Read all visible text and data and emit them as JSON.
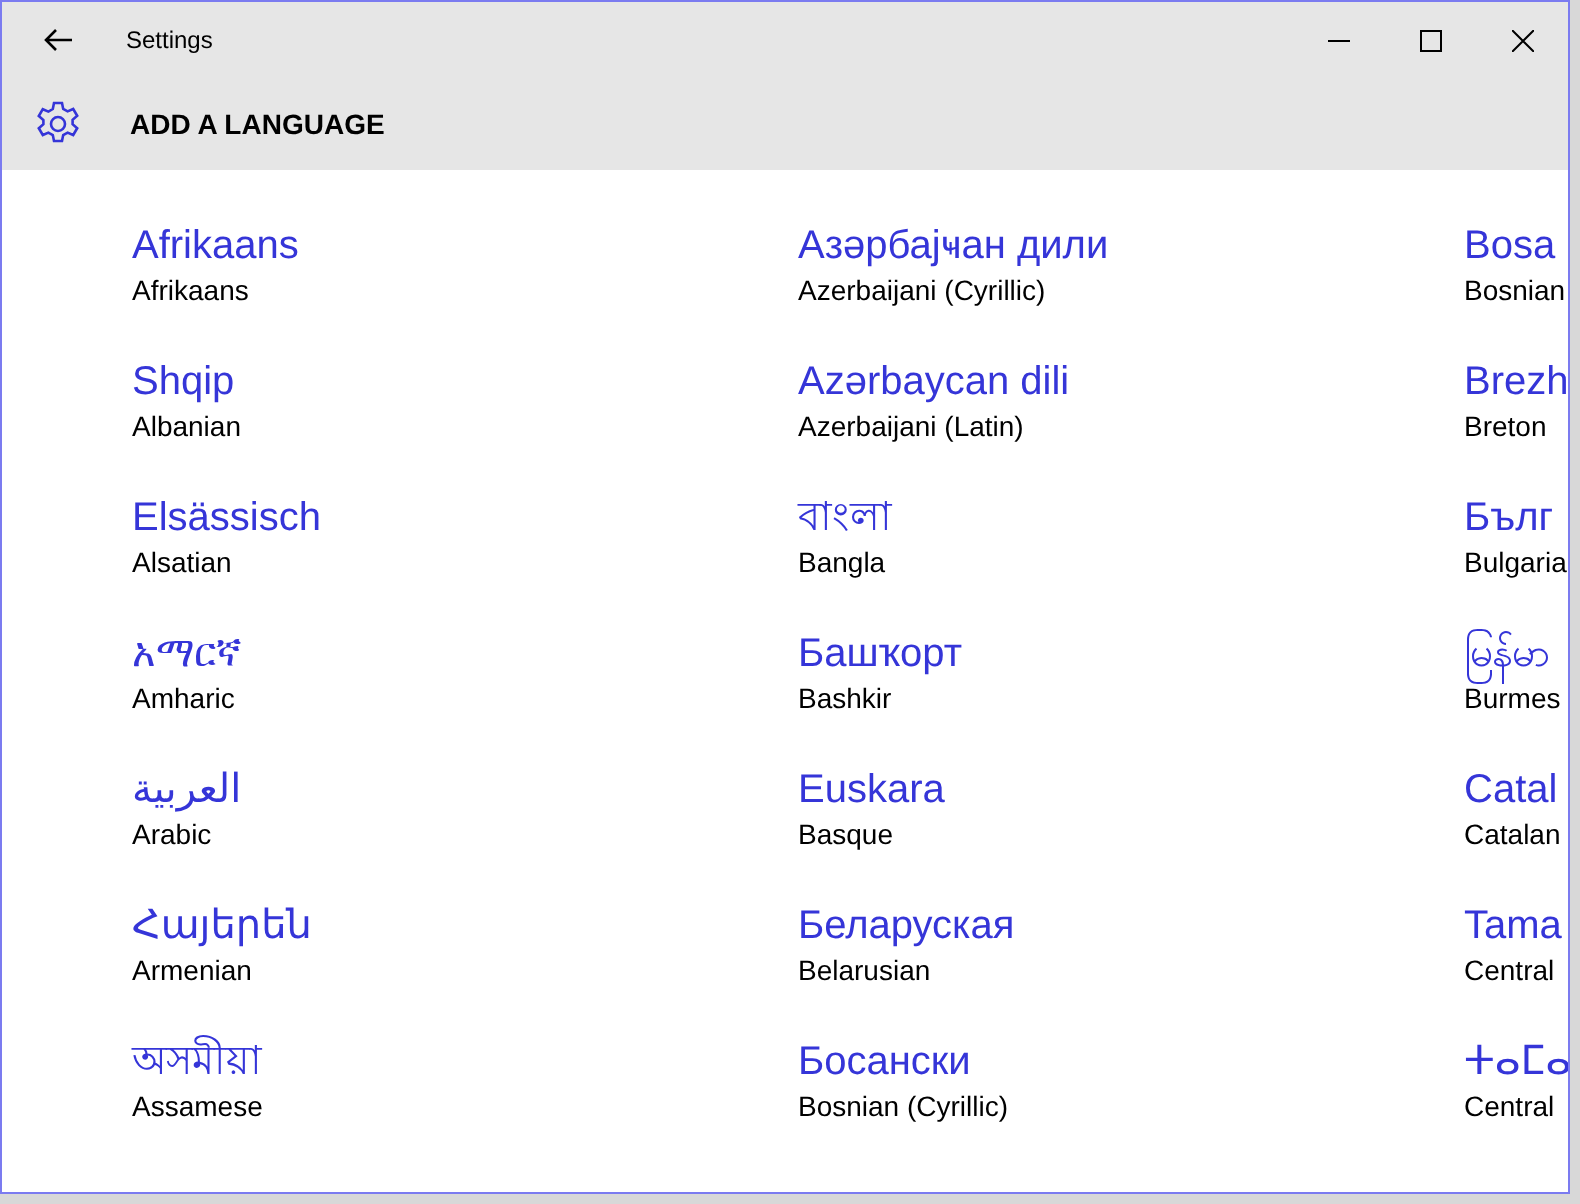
{
  "window": {
    "title": "Settings"
  },
  "header": {
    "title": "ADD A LANGUAGE"
  },
  "languages": [
    {
      "native": "Afrikaans",
      "english": "Afrikaans"
    },
    {
      "native": "Азәрбајҹан дили",
      "english": "Azerbaijani (Cyrillic)"
    },
    {
      "native": "Bosa",
      "english": "Bosnian"
    },
    {
      "native": "Shqip",
      "english": "Albanian"
    },
    {
      "native": "Azərbaycan dili",
      "english": "Azerbaijani (Latin)"
    },
    {
      "native": "Brezh",
      "english": "Breton"
    },
    {
      "native": "Elsässisch",
      "english": "Alsatian"
    },
    {
      "native": "বাংলা",
      "english": "Bangla"
    },
    {
      "native": "Бълг",
      "english": "Bulgaria"
    },
    {
      "native": "አማርኛ",
      "english": "Amharic"
    },
    {
      "native": "Башҡорт",
      "english": "Bashkir"
    },
    {
      "native": "မြန်မာ",
      "english": "Burmes"
    },
    {
      "native": "العربية",
      "english": "Arabic"
    },
    {
      "native": "Euskara",
      "english": "Basque"
    },
    {
      "native": "Catal",
      "english": "Catalan"
    },
    {
      "native": "Հայերեն",
      "english": "Armenian"
    },
    {
      "native": "Беларуская",
      "english": "Belarusian"
    },
    {
      "native": "Tama",
      "english": "Central"
    },
    {
      "native": "অসমীয়া",
      "english": "Assamese"
    },
    {
      "native": "Босански",
      "english": "Bosnian (Cyrillic)"
    },
    {
      "native": "ⵜⴰⵎⴰ",
      "english": "Central"
    }
  ]
}
